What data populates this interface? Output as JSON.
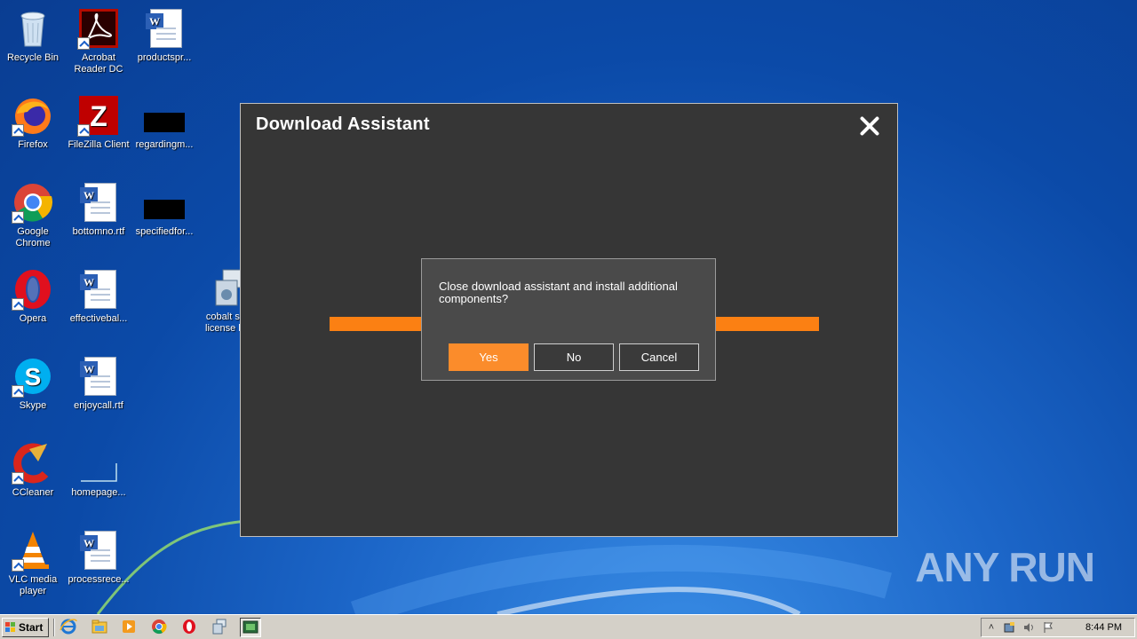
{
  "desktop": {
    "icons": [
      {
        "name": "recycle-bin-icon",
        "label": "Recycle Bin"
      },
      {
        "name": "acrobat-icon",
        "label": "Acrobat Reader DC"
      },
      {
        "name": "word-doc-icon",
        "label": "productspr..."
      },
      {
        "name": "firefox-icon",
        "label": "Firefox"
      },
      {
        "name": "filezilla-icon",
        "label": "FileZilla Client"
      },
      {
        "name": "redacted-file-icon",
        "label": "regardingm..."
      },
      {
        "name": "chrome-icon",
        "label": "Google Chrome"
      },
      {
        "name": "word-doc-icon",
        "label": "bottomno.rtf"
      },
      {
        "name": "redacted-file-icon",
        "label": "specifiedfor..."
      },
      {
        "name": "opera-icon",
        "label": "Opera"
      },
      {
        "name": "word-doc-icon",
        "label": "effectivebal..."
      },
      {
        "name": "installer-icon",
        "label": "cobalt st... license k..."
      },
      {
        "name": "skype-icon",
        "label": "Skype"
      },
      {
        "name": "word-doc-icon",
        "label": "enjoycall.rtf"
      },
      {
        "name": "ccleaner-icon",
        "label": "CCleaner"
      },
      {
        "name": "blank-file-icon",
        "label": "homepage..."
      },
      {
        "name": "vlc-icon",
        "label": "VLC media player"
      },
      {
        "name": "word-doc-icon",
        "label": "processrece..."
      }
    ],
    "watermark": "ANY RUN"
  },
  "app_window": {
    "title": "Download Assistant",
    "progress": 1.0,
    "accent": "#fb8013",
    "background": "#363636"
  },
  "confirm_dialog": {
    "message": "Close download assistant and install additional components?",
    "buttons": {
      "yes": "Yes",
      "no": "No",
      "cancel": "Cancel"
    },
    "primary_color": "#fb8c2b"
  },
  "taskbar": {
    "start_label": "Start",
    "items": [
      "ie-icon",
      "explorer-icon",
      "media-player-icon",
      "chrome-icon",
      "opera-icon",
      "installer-icon",
      "download-assistant-icon"
    ],
    "clock": "8:44 PM"
  }
}
